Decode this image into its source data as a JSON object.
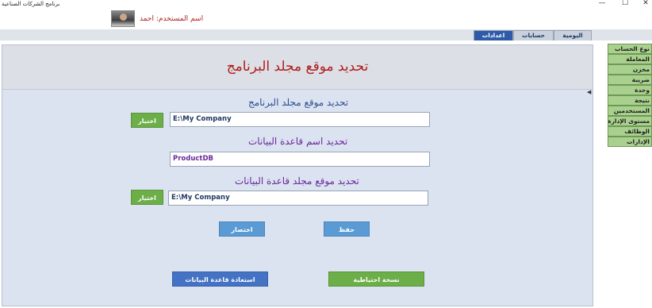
{
  "window": {
    "title": "برنامج الشركات الصناعية",
    "controls": {
      "minimize": "—",
      "maximize": "☐",
      "close": "✕"
    }
  },
  "header": {
    "user_label": "اسم المستخدم: احمد"
  },
  "tabs": [
    {
      "label": "اليومية",
      "active": false
    },
    {
      "label": "حسابات",
      "active": false
    },
    {
      "label": "اعدادات",
      "active": true
    }
  ],
  "main": {
    "title": "تحديد موقع مجلد البرنامج",
    "sections": {
      "program_folder": {
        "label": "تحديد موقع مجلد البرنامج",
        "value": "E:\\My Company",
        "browse_label": "اختيار"
      },
      "db_name": {
        "label": "تحديد اسم قاعدة البيانات",
        "value": "ProductDB"
      },
      "db_folder": {
        "label": "تحديد موقع مجلد قاعدة البيانات",
        "value": "E:\\My Company",
        "browse_label": "اختيار"
      }
    },
    "buttons": {
      "save": "حفظ",
      "shortcut": "اختصار",
      "backup": "نسخة احتياطية",
      "restore": "استعادة قاعدة البيانات"
    }
  },
  "sidebar": {
    "items": [
      {
        "label": "نوع الحساب"
      },
      {
        "label": "المعاملة"
      },
      {
        "label": "مخزن"
      },
      {
        "label": "ضريبة"
      },
      {
        "label": "وحدة"
      },
      {
        "label": "نتيجة"
      },
      {
        "label": "المستخدمين"
      },
      {
        "label": "مستوى الإدارة"
      },
      {
        "label": "الوظائف"
      },
      {
        "label": "الإدارات"
      }
    ]
  },
  "colors": {
    "title_red": "#b01c1c",
    "label_blue": "#2f4f8f",
    "label_purple": "#6a2a9a",
    "sidebar_green": "#a9d08e",
    "button_green": "#6cae47",
    "button_blue": "#5b9bd5",
    "button_darkblue": "#4472c4",
    "active_tab": "#2e5aa8"
  },
  "icons": {
    "scroll_left": "triangle-left-icon"
  }
}
